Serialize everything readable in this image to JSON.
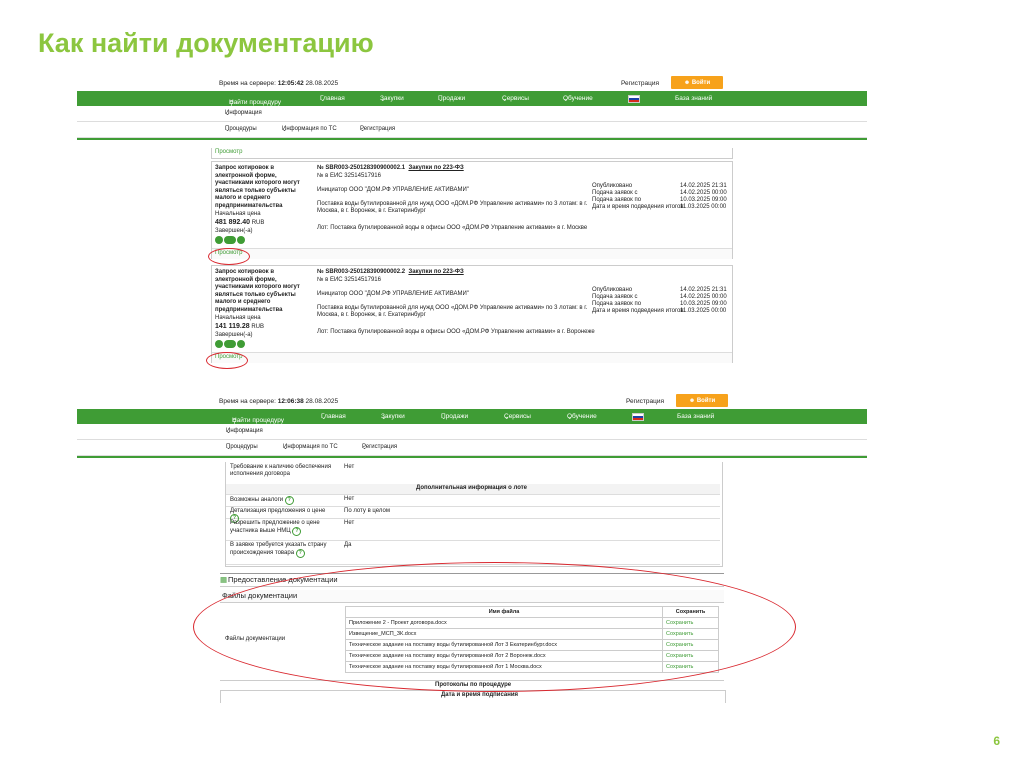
{
  "slide": {
    "title": "Как найти документацию",
    "page_number": "6"
  },
  "shot1": {
    "server_time_label": "Время на сервере:",
    "server_time": "12:05:42",
    "server_date": "28.08.2025",
    "register": "Регистрация",
    "login": "Войти",
    "nav": [
      "Найти процедуру",
      "Главная",
      "Закупки",
      "Продажи",
      "Сервисы",
      "Обучение",
      "База знаний"
    ],
    "info": "Информация",
    "subnav": [
      "Процедуры",
      "Информация по ТС",
      "Регистрация"
    ],
    "prev_view": "Просмотр",
    "cards": [
      {
        "desc": "Запрос котировок в электронной форме, участниками которого могут являться только субъекты малого и среднего предпринимательства",
        "price_label": "Начальная цена",
        "price": "481 892.40",
        "currency": "RUB",
        "completed": "Завершен(-а)",
        "number": "№ SBR003-250128390900002.1",
        "law": "Закупки по 223-ФЗ",
        "eis": "№ в ЕИС 32514517916",
        "initiator": "Инициатор ООО \"ДОМ.РФ УПРАВЛЕНИЕ АКТИВАМИ\"",
        "subject": "Поставка воды бутилированной для нужд ООО «ДОМ.РФ Управление активами» по 3 лотам: в г. Москва, в г. Воронеж, в г. Екатеринбург",
        "lot": "Лот: Поставка бутилированной воды в офисы ООО «ДОМ.РФ Управление активами» в г. Москве",
        "dates": [
          {
            "k": "Опубликовано",
            "v": "14.02.2025 21:31"
          },
          {
            "k": "Подача заявок с",
            "v": "14.02.2025 00:00"
          },
          {
            "k": "Подача заявок по",
            "v": "10.03.2025 09:00"
          },
          {
            "k": "Дата и время подведения итогов",
            "v": "11.03.2025 00:00"
          }
        ],
        "view": "Просмотр"
      },
      {
        "desc": "Запрос котировок в электронной форме, участниками которого могут являться только субъекты малого и среднего предпринимательства",
        "price_label": "Начальная цена",
        "price": "141 119.28",
        "currency": "RUB",
        "completed": "Завершен(-а)",
        "number": "№ SBR003-250128390900002.2",
        "law": "Закупки по 223-ФЗ",
        "eis": "№ в ЕИС 32514517916",
        "initiator": "Инициатор ООО \"ДОМ.РФ УПРАВЛЕНИЕ АКТИВАМИ\"",
        "subject": "Поставка воды бутилированной для нужд ООО «ДОМ.РФ Управление активами» по 3 лотам: в г. Москва, в г. Воронеж, в г. Екатеринбург",
        "lot": "Лот: Поставка бутилированной воды в офисы ООО «ДОМ.РФ Управление активами» в г. Воронеже",
        "dates": [
          {
            "k": "Опубликовано",
            "v": "14.02.2025 21:31"
          },
          {
            "k": "Подача заявок с",
            "v": "14.02.2025 00:00"
          },
          {
            "k": "Подача заявок по",
            "v": "10.03.2025 09:00"
          },
          {
            "k": "Дата и время подведения итогов",
            "v": "11.03.2025 00:00"
          }
        ],
        "view": "Просмотр"
      }
    ]
  },
  "shot2": {
    "server_time_label": "Время на сервере:",
    "server_time": "12:06:38",
    "server_date": "28.08.2025",
    "register": "Регистрация",
    "login": "Войти",
    "nav": [
      "Найти процедуру",
      "Главная",
      "Закупки",
      "Продажи",
      "Сервисы",
      "Обучение",
      "База знаний"
    ],
    "info": "Информация",
    "subnav": [
      "Процедуры",
      "Информация по ТС",
      "Регистрация"
    ],
    "req_key": "Требование к наличию обеспечения исполнения договора",
    "req_val": "Нет",
    "extra_header": "Дополнительная информация о лоте",
    "rows": [
      {
        "k": "Возможны аналоги",
        "v": "Нет"
      },
      {
        "k": "Детализация предложения о цене",
        "v": "По лоту в целом"
      },
      {
        "k": "Разрешить предложение о цене участника выше НМЦ",
        "v": "Нет"
      },
      {
        "k": "В заявке требуется указать страну происхождения товара",
        "v": "Да"
      }
    ],
    "docs_section": "Предоставление документации",
    "files_heading": "Файлы документации",
    "files_label": "Файлы документации",
    "col_name": "Имя файла",
    "col_save": "Сохранить",
    "files": [
      {
        "name": "Приложение 2 - Проект договора.docx",
        "save": "Сохранить"
      },
      {
        "name": "Извещение_МСП_ЗК.docx",
        "save": "Сохранить"
      },
      {
        "name": "Техническое задание на поставку воды бутилированной Лот 3 Екатеринбург.docx",
        "save": "Сохранить"
      },
      {
        "name": "Техническое задание на поставку воды бутилированной Лот 2 Воронеж.docx",
        "save": "Сохранить"
      },
      {
        "name": "Техническое задание на поставку воды бутилированной Лот 1 Москва.docx",
        "save": "Сохранить"
      }
    ],
    "protocols": "Протоколы по процедуре",
    "protocols_sub": "Дата и время подписания"
  }
}
